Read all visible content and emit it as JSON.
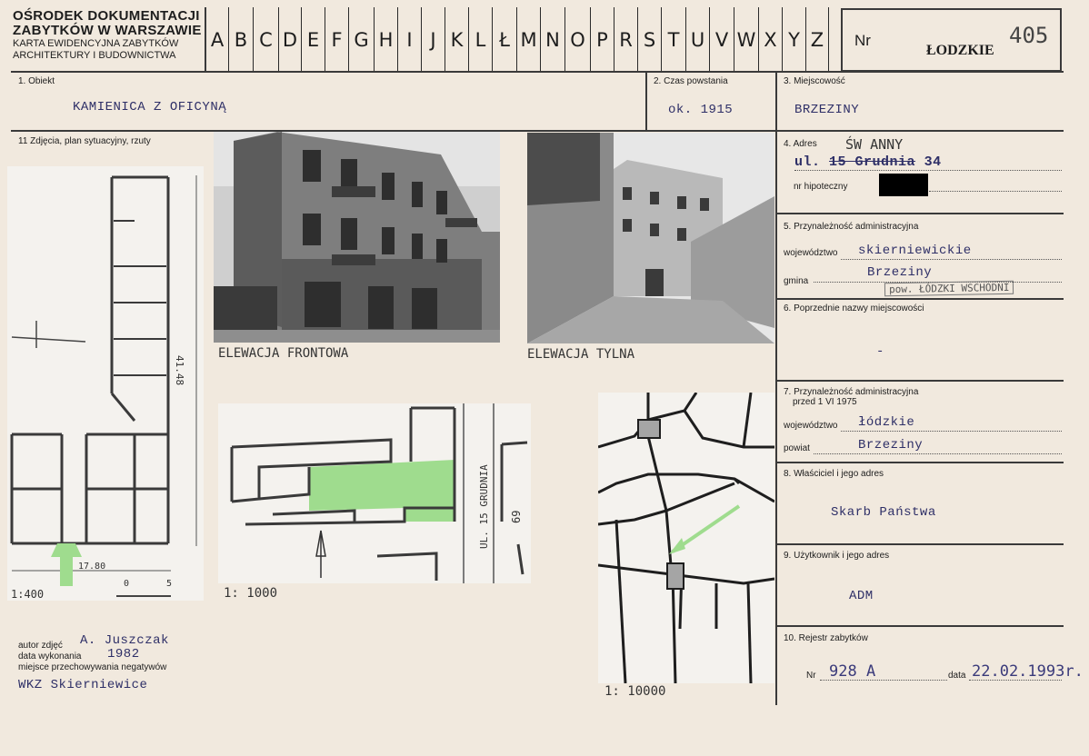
{
  "header": {
    "org_line1": "ŚRODEK DOKUMENTACJI",
    "org_line2": "ZABYTKÓW W WARSZAWIE",
    "org_line3": "KARTA EWIDENCYJNA ZABYTKÓW",
    "org_line4": "ARCHITEKTURY I BUDOWNICTWA",
    "org_first_letter": "O",
    "letters": [
      "A",
      "B",
      "C",
      "D",
      "E",
      "F",
      "G",
      "H",
      "I",
      "J",
      "K",
      "L",
      "Ł",
      "M",
      "N",
      "O",
      "P",
      "R",
      "S",
      "T",
      "U",
      "V",
      "W",
      "X",
      "Y",
      "Z"
    ],
    "nr_label": "Nr",
    "region": "ŁODZKIE",
    "number": "405"
  },
  "fields": {
    "obiekt": {
      "label": "1. Obiekt",
      "value": "KAMIENICA Z OFICYNĄ"
    },
    "czas": {
      "label": "2. Czas powstania",
      "value": "ok. 1915"
    },
    "miejscowosc": {
      "label": "3. Miejscowość",
      "value": "BRZEZINY"
    },
    "zdjecia": {
      "label": "11 Zdjęcia, plan sytuacyjny, rzuty"
    },
    "adres": {
      "label": "4. Adres",
      "handwritten_street": "ŚW ANNY",
      "prefix": "ul.",
      "struck": "15 Grudnia",
      "number": "34",
      "hipoteczny_label": "nr hipoteczny"
    },
    "przynaleznosc": {
      "label": "5. Przynależność administracyjna",
      "woj_label": "województwo",
      "woj_value": "skierniewickie",
      "gmina_label": "gmina",
      "gmina_value": "Brzeziny",
      "stamp": "pow. ŁÓDZKI WSCHODNI"
    },
    "poprzednie": {
      "label": "6. Poprzednie nazwy miejscowości",
      "value": "-"
    },
    "przynaleznosc_1975": {
      "label_line1": "7. Przynależność administracyjna",
      "label_line2": "przed 1 VI 1975",
      "woj_label": "województwo",
      "woj_value": "łódzkie",
      "powiat_label": "powiat",
      "powiat_value": "Brzeziny"
    },
    "wlasciciel": {
      "label": "8. Właściciel i jego adres",
      "value": "Skarb Państwa"
    },
    "uzytkownik": {
      "label": "9. Użytkownik i jego adres",
      "value": "ADM"
    },
    "rejestr": {
      "label": "10. Rejestr zabytków",
      "nr_label": "Nr",
      "nr_value": "928 A",
      "data_label": "data",
      "data_value": "22.02.1993r."
    }
  },
  "photos": {
    "front_caption": "ELEWACJA FRONTOWA",
    "rear_caption": "ELEWACJA TYLNA"
  },
  "drawings": {
    "plan_dim_length": "41.48",
    "plan_dim_width": "17.80",
    "plan_scale": "1:400",
    "scale_bar_0": "0",
    "scale_bar_5": "5",
    "site_scale": "1: 1000",
    "site_street": "UL. 15 GRUDNIA",
    "site_number": "69",
    "map_scale": "1: 10000"
  },
  "credits": {
    "autor_label": "autor zdjęć",
    "autor_value": "A. Juszczak",
    "data_label": "data wykonania",
    "data_value": "1982",
    "miejsce_label": "miejsce przechowywania negatywów",
    "miejsce_value": "WKZ Skierniewice"
  },
  "colors": {
    "paper": "#f1e9de",
    "typewriter": "#2e2f67",
    "highlight": "#9fdc8e",
    "rule": "#3a3a3a"
  }
}
